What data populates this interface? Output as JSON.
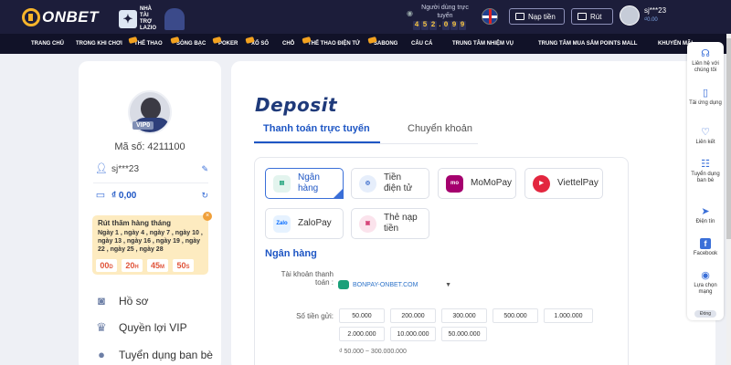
{
  "header": {
    "logo_text": "ONBET",
    "partner_text": "NHÀ TÀI TRỢ LAZIO",
    "counter_label": "Người dùng trực tuyến",
    "counter_digits": [
      "4",
      "5",
      "2",
      ".",
      "0",
      "9",
      "9"
    ],
    "deposit_button": "Nạp tiền",
    "withdraw_button": "Rút",
    "username": "sj***23",
    "balance": "₫0.00"
  },
  "nav": {
    "items": [
      "TRANG CHỦ",
      "TRONG KHI CHƠI",
      "THỂ THAO",
      "SÒNG BẠC",
      "POKER",
      "XỔ SỐ",
      "CHỖ",
      "THỂ THAO ĐIỆN TỬ",
      "SABONG",
      "CÂU CÁ",
      "TRUNG TÂM NHIỆM VỤ",
      "TRUNG TÂM MUA SẮM POINTS MALL",
      "KHUYẾN MÃI"
    ]
  },
  "profile": {
    "vip": "VIP0",
    "member_id": "Mã số: 4211100",
    "username": "sj***23",
    "balance": "₫ 0,00",
    "promo_title": "Rút thăm hàng tháng",
    "promo_days": "Ngày 1 , ngày 4 , ngày 7 , ngày 10 , ngày 13 , ngày 16 , ngày 19 , ngày 22 , ngày 25 , ngày 28",
    "timer": [
      {
        "value": "00",
        "unit": "D"
      },
      {
        "value": "20",
        "unit": "H"
      },
      {
        "value": "45",
        "unit": "M"
      },
      {
        "value": "50",
        "unit": "S"
      }
    ],
    "menu": [
      "Hồ sơ",
      "Quyền lợi VIP",
      "Tuyển dụng ban bè"
    ]
  },
  "deposit": {
    "title": "Deposit",
    "tabs": [
      "Thanh toán trực tuyến",
      "Chuyển khoản"
    ],
    "methods": [
      {
        "label": "Ngân hàng",
        "color": "#1aa079"
      },
      {
        "label": "Tiền điện tử",
        "color": "#1e56c4"
      },
      {
        "label": "MoMoPay",
        "color": "#a5006e"
      },
      {
        "label": "ViettelPay",
        "color": "#e3263f"
      },
      {
        "label": "ZaloPay",
        "color": "#0068ff"
      },
      {
        "label": "Thẻ nạp tiền",
        "color": "#d6457a"
      }
    ],
    "section_title": "Ngân hàng",
    "account_label": "Tài khoản thanh toán :",
    "account_value": "BONPAY-ONBET.COM",
    "amount_label": "Số tiền gửi:",
    "amounts": [
      "50.000",
      "200.000",
      "300.000",
      "500.000",
      "1.000.000",
      "2.000.000",
      "10.000.000",
      "50.000.000"
    ],
    "range": "₫ 50.000 ~ 300.000.000"
  },
  "sidebar": {
    "items": [
      "Liên hệ với chúng tôi",
      "Tải ứng dụng",
      "Liên kết",
      "Tuyển dụng ban bè",
      "Điện tín",
      "Facebook",
      "Lựa chọn mạng"
    ],
    "close": "Đóng"
  }
}
